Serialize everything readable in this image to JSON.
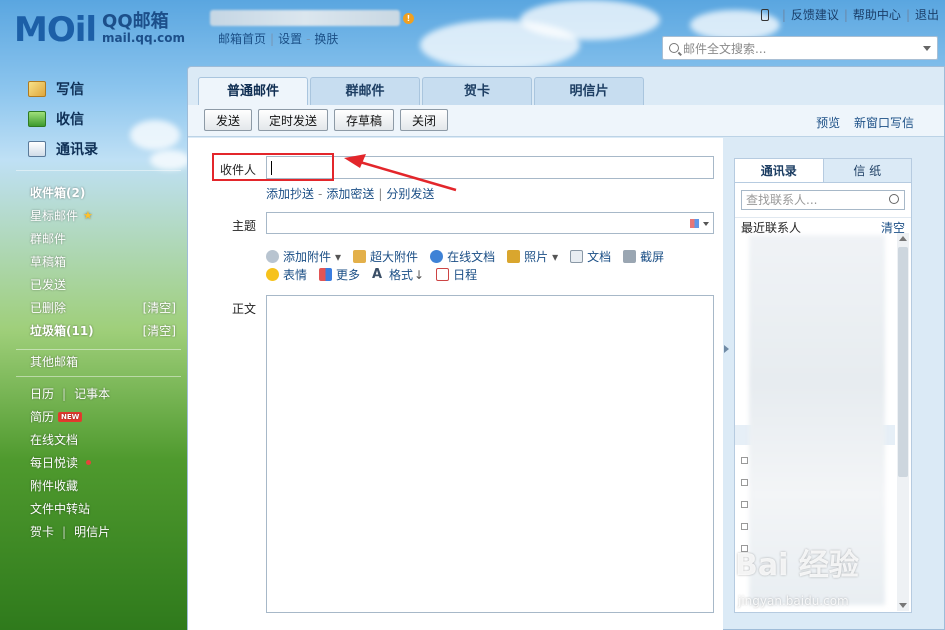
{
  "header": {
    "logo_mark": "MOil",
    "logo_title": "QQ邮箱",
    "logo_domain": "mail.qq.com",
    "links": [
      "邮箱首页",
      "设置",
      "换肤"
    ],
    "right_links": [
      "反馈建议",
      "帮助中心",
      "退出"
    ],
    "search_placeholder": "邮件全文搜索..."
  },
  "sidebar": {
    "actions": [
      {
        "label": "写信",
        "icon": "write-icon"
      },
      {
        "label": "收信",
        "icon": "inbox-icon"
      },
      {
        "label": "通讯录",
        "icon": "contacts-icon"
      }
    ],
    "folders": {
      "inbox": "收件箱(2)",
      "starred": "星标邮件",
      "group": "群邮件",
      "drafts": "草稿箱",
      "sent": "已发送",
      "deleted": "已删除",
      "deleted_clear": "[清空]",
      "spam": "垃圾箱(11)",
      "spam_clear": "[清空]",
      "other": "其他邮箱",
      "calendar": "日历",
      "notepad": "记事本",
      "resume": "简历",
      "resume_badge": "NEW",
      "docs": "在线文档",
      "daily": "每日悦读",
      "attachments": "附件收藏",
      "transfer": "文件中转站",
      "greeting": "贺卡",
      "postcard": "明信片"
    }
  },
  "main": {
    "tabs": [
      "普通邮件",
      "群邮件",
      "贺卡",
      "明信片"
    ],
    "toolbar": {
      "send": "发送",
      "schedule": "定时发送",
      "save_draft": "存草稿",
      "close": "关闭",
      "preview": "预览",
      "new_window": "新窗口写信"
    },
    "compose": {
      "to_label": "收件人",
      "add_cc": "添加抄送",
      "add_bcc": "添加密送",
      "separate_send": "分别发送",
      "subject_label": "主题",
      "body_label": "正文",
      "tools_row1": [
        "添加附件",
        "超大附件",
        "在线文档",
        "照片",
        "文档",
        "截屏"
      ],
      "tools_row2": [
        "表情",
        "更多",
        "格式",
        "日程"
      ]
    },
    "contacts": {
      "tab_contacts": "通讯录",
      "tab_stationery": "信 纸",
      "search_placeholder": "查找联系人...",
      "recent": "最近联系人",
      "clear": "清空"
    }
  },
  "watermark": {
    "main": "Bai 经验",
    "sub": "jingyan.baidu.com"
  }
}
